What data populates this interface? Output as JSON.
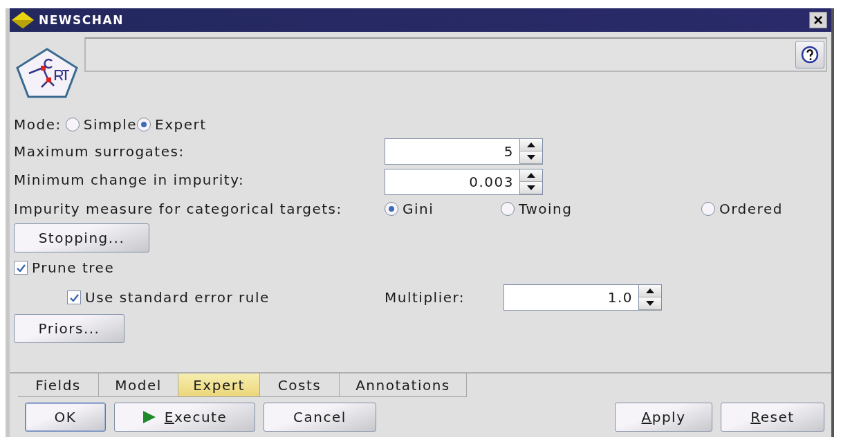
{
  "window": {
    "title": "NEWSCHAN"
  },
  "mode": {
    "label": "Mode:",
    "options": [
      {
        "label": "Simple",
        "selected": false
      },
      {
        "label": "Expert",
        "selected": true
      }
    ]
  },
  "fields": [
    {
      "label": "Maximum surrogates:",
      "value": "5"
    },
    {
      "label": "Minimum change in impurity:",
      "value": "0.003"
    }
  ],
  "impurity": {
    "label": "Impurity measure for categorical targets:",
    "options": [
      {
        "label": "Gini",
        "selected": true
      },
      {
        "label": "Twoing",
        "selected": false
      },
      {
        "label": "Ordered",
        "selected": false
      }
    ]
  },
  "stopping_button": "Stopping...",
  "prune": {
    "label": "Prune tree",
    "checked": true
  },
  "standard_error": {
    "label": "Use standard error rule",
    "checked": true,
    "multiplier_label": "Multiplier:",
    "multiplier_value": "1.0"
  },
  "priors_button": "Priors...",
  "tabs": [
    {
      "label": "Fields",
      "selected": false
    },
    {
      "label": "Model",
      "selected": false
    },
    {
      "label": "Expert",
      "selected": true
    },
    {
      "label": "Costs",
      "selected": false
    },
    {
      "label": "Annotations",
      "selected": false
    }
  ],
  "buttons_left": [
    {
      "label": "OK",
      "kind": "default",
      "mnemonic": false
    },
    {
      "label": "Execute",
      "kind": "run",
      "mnemonic": true
    },
    {
      "label": "Cancel",
      "kind": "plain",
      "mnemonic": false
    }
  ],
  "buttons_right": [
    {
      "label": "Apply",
      "kind": "plain",
      "mnemonic": true
    },
    {
      "label": "Reset",
      "kind": "plain",
      "mnemonic": true
    }
  ]
}
